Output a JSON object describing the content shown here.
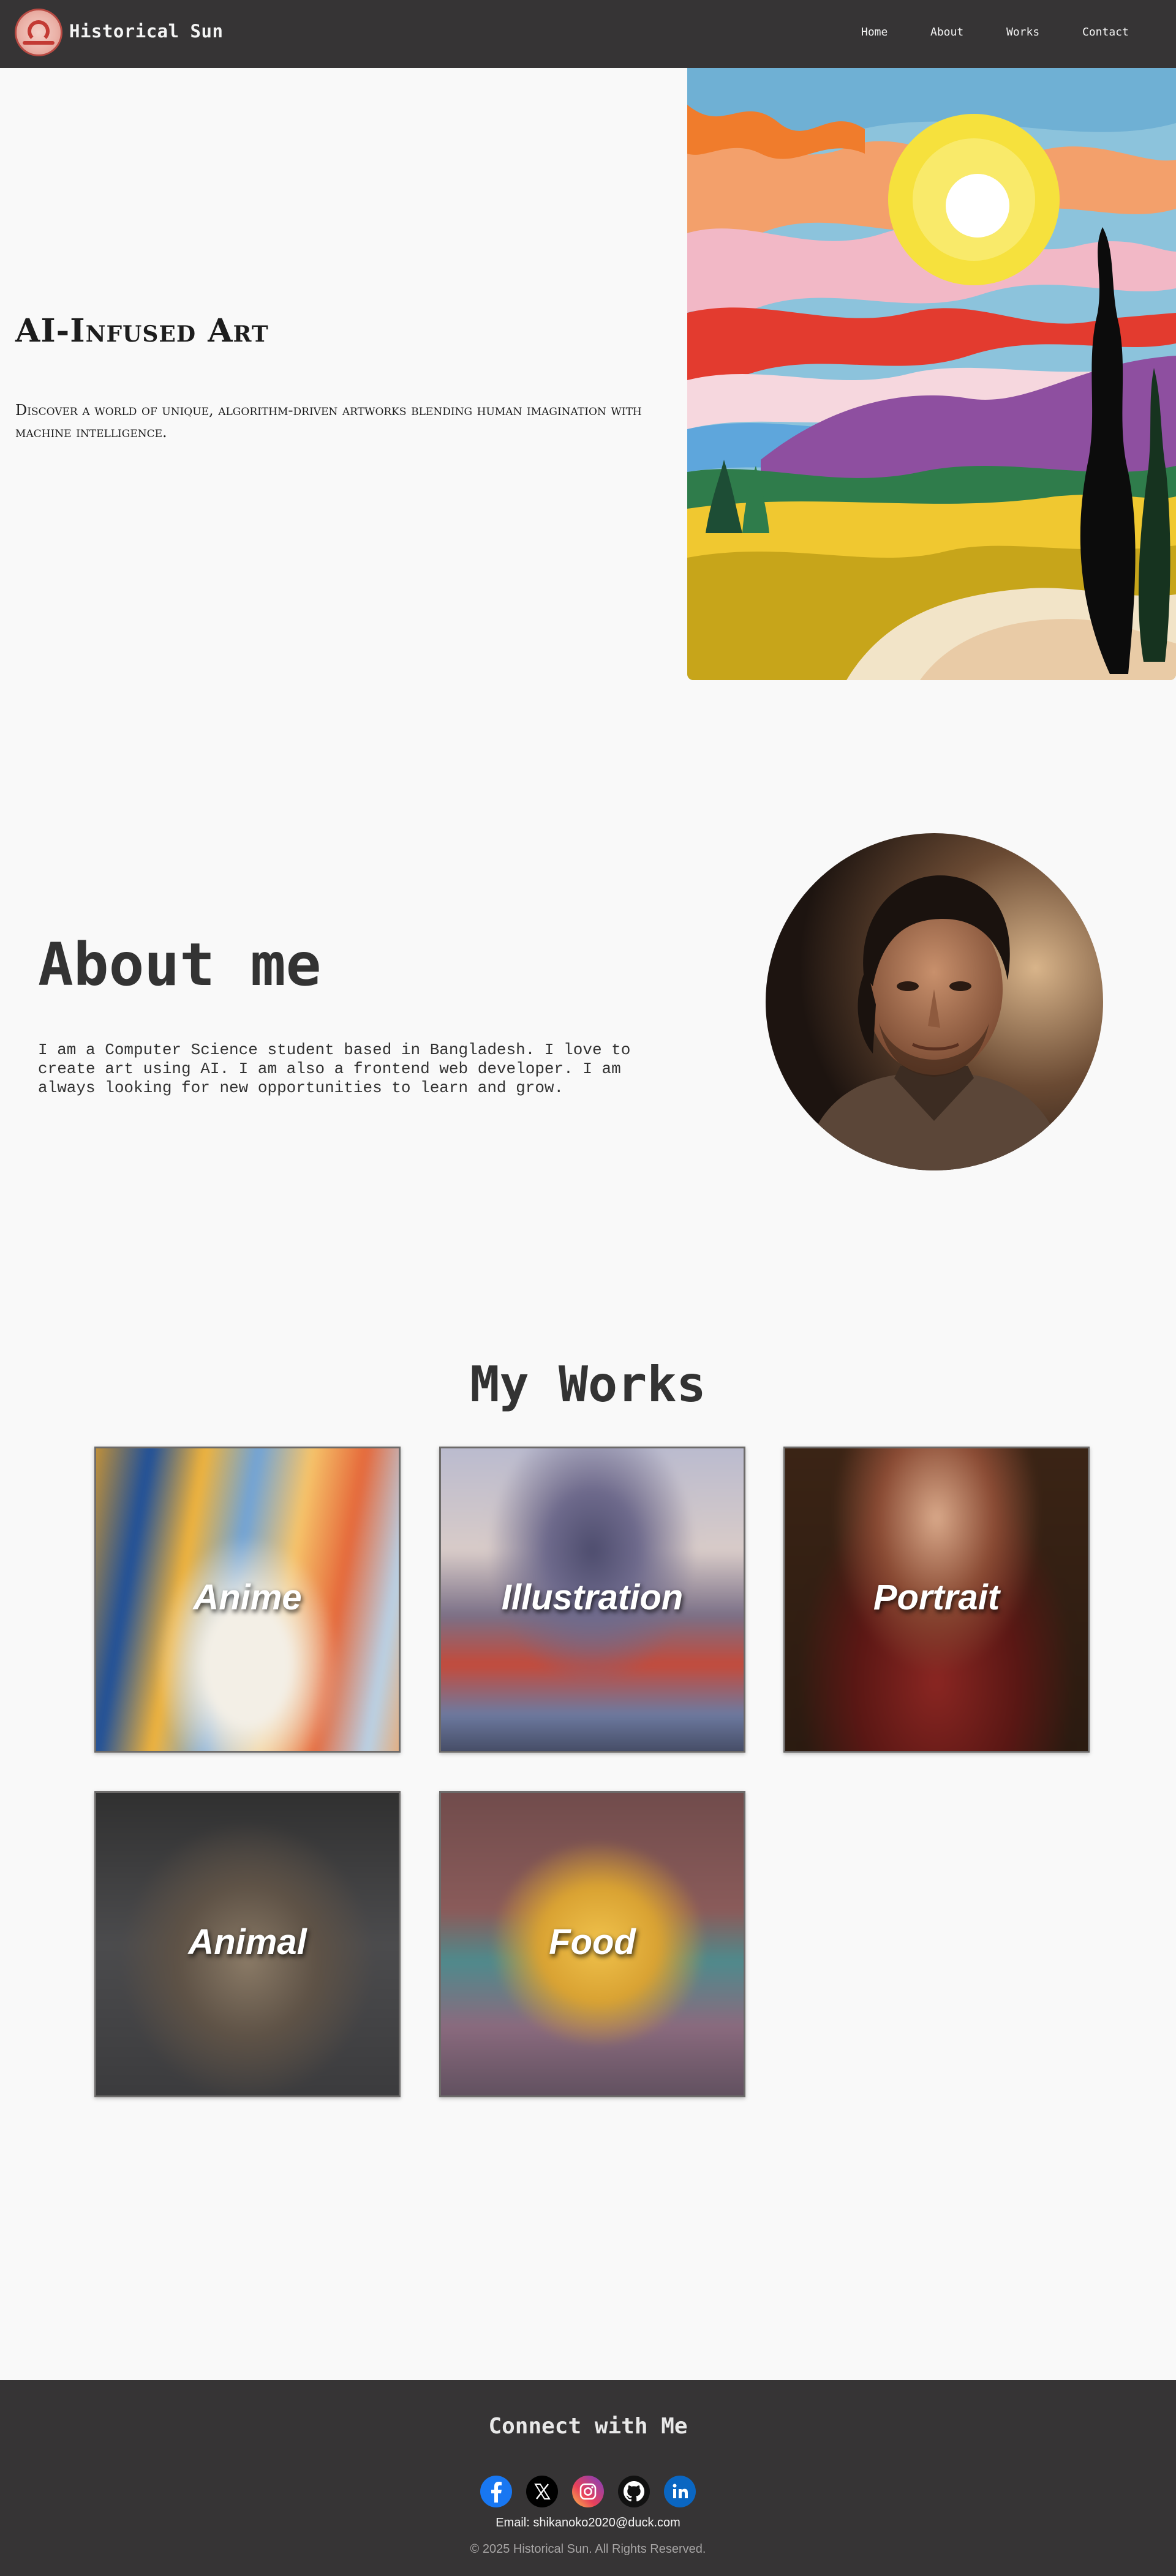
{
  "nav": {
    "brand": "Historical Sun",
    "links": [
      "Home",
      "About",
      "Works",
      "Contact"
    ]
  },
  "hero": {
    "title": "AI-Infused Art",
    "text": "Discover a world of unique, algorithm-driven artworks blending human imagination with machine intelligence."
  },
  "about": {
    "title": "About me",
    "text": "I am a Computer Science student based in Bangladesh. I love to create art using AI. I am also a frontend web developer. I am always looking for new opportunities to learn and grow."
  },
  "works": {
    "title": "My Works",
    "cards": [
      "Anime",
      "Illustration",
      "Portrait",
      "Animal",
      "Food"
    ]
  },
  "footer": {
    "title": "Connect with Me",
    "social": [
      "facebook-icon",
      "x-icon",
      "instagram-icon",
      "github-icon",
      "linkedin-icon"
    ],
    "email": "Email: shikanoko2020@duck.com",
    "copyright": "© 2025 Historical Sun. All Rights Reserved."
  },
  "colors": {
    "nav_bg": "#363435",
    "page_bg": "#f9f9f9",
    "text": "#333333"
  }
}
